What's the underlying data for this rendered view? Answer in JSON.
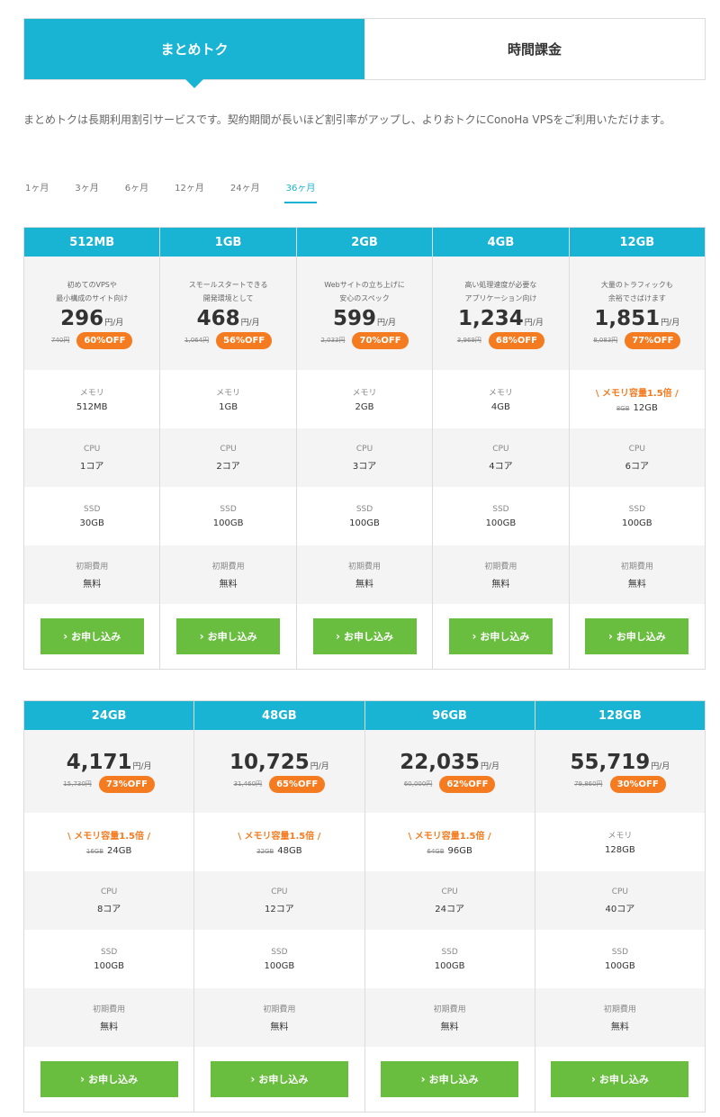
{
  "tabs": [
    {
      "label": "まとめトク",
      "active": true
    },
    {
      "label": "時間課金",
      "active": false
    }
  ],
  "description": "まとめトクは長期利用割引サービスです。契約期間が長いほど割引率がアップし、よりおトクにConoHa VPSをご利用いただけます。",
  "durations": [
    {
      "label": "1ヶ月",
      "active": false
    },
    {
      "label": "3ヶ月",
      "active": false
    },
    {
      "label": "6ヶ月",
      "active": false
    },
    {
      "label": "12ヶ月",
      "active": false
    },
    {
      "label": "24ヶ月",
      "active": false
    },
    {
      "label": "36ヶ月",
      "active": true
    }
  ],
  "labels": {
    "unit": "円/月",
    "memory": "メモリ",
    "memory_promo": "\\ メモリ容量1.5倍 /",
    "cpu": "CPU",
    "ssd": "SSD",
    "initial_cost": "初期費用",
    "free": "無料",
    "apply": "お申し込み"
  },
  "plans_row1": [
    {
      "name": "512MB",
      "tagline1": "初めてのVPSや",
      "tagline2": "最小構成のサイト向け",
      "price": "296",
      "orig": "740円",
      "off": "60%OFF",
      "promo": false,
      "memory_old": "",
      "memory": "512MB",
      "cpu": "1コア",
      "ssd": "30GB"
    },
    {
      "name": "1GB",
      "tagline1": "スモールスタートできる",
      "tagline2": "開発環境として",
      "price": "468",
      "orig": "1,064円",
      "off": "56%OFF",
      "promo": false,
      "memory_old": "",
      "memory": "1GB",
      "cpu": "2コア",
      "ssd": "100GB"
    },
    {
      "name": "2GB",
      "tagline1": "Webサイトの立ち上げに",
      "tagline2": "安心のスペック",
      "price": "599",
      "orig": "2,033円",
      "off": "70%OFF",
      "promo": false,
      "memory_old": "",
      "memory": "2GB",
      "cpu": "3コア",
      "ssd": "100GB"
    },
    {
      "name": "4GB",
      "tagline1": "高い処理速度が必要な",
      "tagline2": "アプリケーション向け",
      "price": "1,234",
      "orig": "3,969円",
      "off": "68%OFF",
      "promo": false,
      "memory_old": "",
      "memory": "4GB",
      "cpu": "4コア",
      "ssd": "100GB"
    },
    {
      "name": "12GB",
      "tagline1": "大量のトラフィックも",
      "tagline2": "余裕でさばけます",
      "price": "1,851",
      "orig": "8,083円",
      "off": "77%OFF",
      "promo": true,
      "memory_old": "8GB",
      "memory": "12GB",
      "cpu": "6コア",
      "ssd": "100GB"
    }
  ],
  "plans_row2": [
    {
      "name": "24GB",
      "price": "4,171",
      "orig": "15,730円",
      "off": "73%OFF",
      "promo": true,
      "memory_old": "16GB",
      "memory": "24GB",
      "cpu": "8コア",
      "ssd": "100GB"
    },
    {
      "name": "48GB",
      "price": "10,725",
      "orig": "31,460円",
      "off": "65%OFF",
      "promo": true,
      "memory_old": "32GB",
      "memory": "48GB",
      "cpu": "12コア",
      "ssd": "100GB"
    },
    {
      "name": "96GB",
      "price": "22,035",
      "orig": "60,000円",
      "off": "62%OFF",
      "promo": true,
      "memory_old": "64GB",
      "memory": "96GB",
      "cpu": "24コア",
      "ssd": "100GB"
    },
    {
      "name": "128GB",
      "price": "55,719",
      "orig": "79,860円",
      "off": "30%OFF",
      "promo": false,
      "memory_old": "",
      "memory": "128GB",
      "cpu": "40コア",
      "ssd": "100GB"
    }
  ],
  "colors": {
    "accent": "#19b3d3",
    "discount": "#f47b20",
    "button": "#69be3f"
  },
  "icons": {
    "apply": "chevron-right-icon"
  }
}
